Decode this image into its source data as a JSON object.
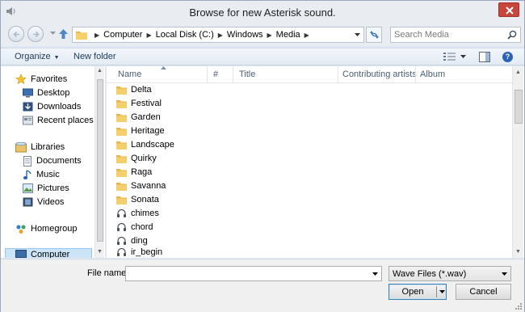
{
  "window": {
    "title": "Browse for new Asterisk sound.",
    "close_label": "×"
  },
  "address": {
    "crumbs": [
      "Computer",
      "Local Disk (C:)",
      "Windows",
      "Media"
    ],
    "search_placeholder": "Search Media"
  },
  "toolbar": {
    "organize": "Organize",
    "new_folder": "New folder",
    "help": "?"
  },
  "nav": {
    "favorites": "Favorites",
    "favorites_items": [
      "Desktop",
      "Downloads",
      "Recent places"
    ],
    "libraries": "Libraries",
    "libraries_items": [
      "Documents",
      "Music",
      "Pictures",
      "Videos"
    ],
    "homegroup": "Homegroup",
    "computer": "Computer"
  },
  "columns": {
    "name": "Name",
    "number": "#",
    "title": "Title",
    "artists": "Contributing artists",
    "album": "Album"
  },
  "files": {
    "folders": [
      "Delta",
      "Festival",
      "Garden",
      "Heritage",
      "Landscape",
      "Quirky",
      "Raga",
      "Savanna",
      "Sonata"
    ],
    "sounds": [
      "chimes",
      "chord",
      "ding",
      "ir_begin"
    ]
  },
  "bottom": {
    "file_name_label": "File name:",
    "file_name_value": "",
    "file_type": "Wave Files (*.wav)",
    "open": "Open",
    "cancel": "Cancel"
  },
  "colors": {
    "folder": "#e8b94a",
    "accent": "#3c7fb1",
    "close": "#c8453b"
  }
}
